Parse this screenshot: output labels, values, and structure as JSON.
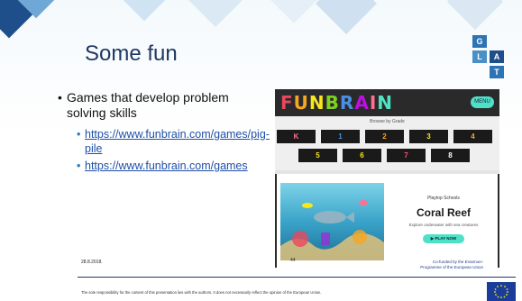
{
  "slide": {
    "title": "Some fun",
    "bullet": "Games that develop problem solving skills",
    "links": [
      "https://www.funbrain.com/games/pig-pile",
      "https://www.funbrain.com/games"
    ],
    "footer_date": "28.8.2018.",
    "page_number": "44",
    "cofunded": "Co-funded by the Erasmus+ Programme of the European Union",
    "disclaimer": "The sole responsibility for the content of this presentation lies with the authors. It does not necessarily reflect the opinion of the European Union."
  },
  "corner_logo": {
    "letters": [
      "G",
      "L",
      "A",
      "T"
    ],
    "colors": [
      "#2e74b5",
      "#4a90c8",
      "#1f4f8a",
      "#2e74b5"
    ]
  },
  "funbrain": {
    "logo": "FUNBRAIN",
    "logo_colors": [
      "#e8485f",
      "#f5a623",
      "#f8e71c",
      "#7ed321",
      "#4a90e2",
      "#bd10e0",
      "#ff6f91",
      "#50e3c2"
    ],
    "menu_label": "MENU",
    "grades_label": "Browse by Grade",
    "grades_row1": [
      "K",
      "1",
      "2",
      "3",
      "4"
    ],
    "grades_row2": [
      "5",
      "6",
      "7",
      "8"
    ],
    "grade_colors_row1": [
      "#ff6f91",
      "#4a90e2",
      "#f5a623",
      "#f8e71c",
      "#f5a623"
    ],
    "grade_colors_row2": [
      "#f8e71c",
      "#f8e71c",
      "#ff4f6f",
      "#ffffff"
    ],
    "game_source": "Playtop Schools",
    "game_title": "Coral Reef",
    "game_subtitle": "Explore underwater with sea creatures",
    "play_label": "▶ PLAY NOW"
  }
}
